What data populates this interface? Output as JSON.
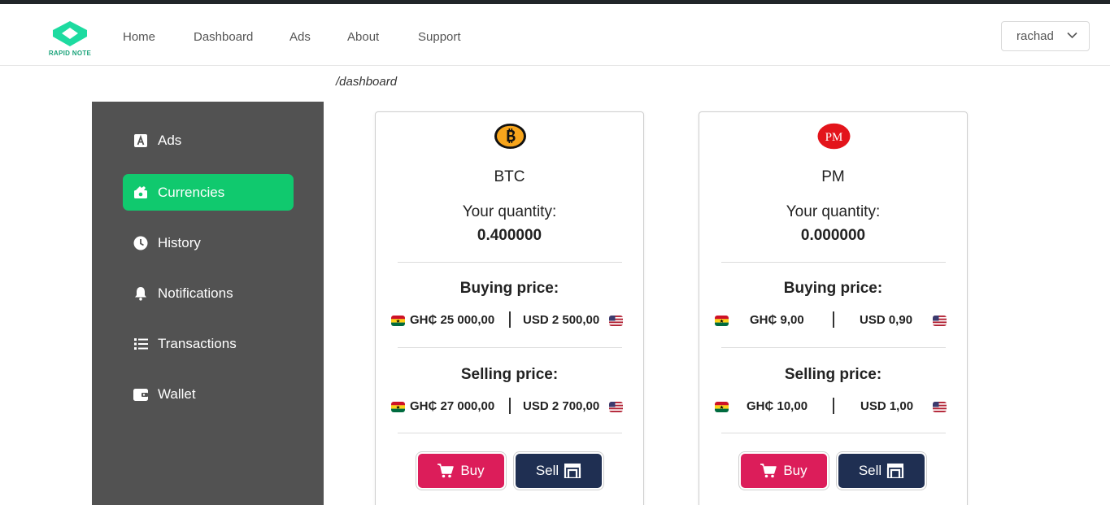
{
  "brand": {
    "name": "RAPID NOTE",
    "accent": "#1ddba0"
  },
  "nav": {
    "items": [
      {
        "label": "Home"
      },
      {
        "label": "Dashboard"
      },
      {
        "label": "Ads"
      },
      {
        "label": "About"
      },
      {
        "label": "Support"
      }
    ]
  },
  "user": {
    "name": "rachad"
  },
  "breadcrumb": "/dashboard",
  "sidebar": {
    "background": "#525252",
    "active_color": "#10c96e",
    "items": [
      {
        "label": "Ads",
        "icon": "ads-icon",
        "active": false
      },
      {
        "label": "Currencies",
        "icon": "currencies-icon",
        "active": true
      },
      {
        "label": "History",
        "icon": "clock-icon",
        "active": false
      },
      {
        "label": "Notifications",
        "icon": "bell-icon",
        "active": false
      },
      {
        "label": "Transactions",
        "icon": "list-icon",
        "active": false
      },
      {
        "label": "Wallet",
        "icon": "wallet-icon",
        "active": false
      }
    ]
  },
  "cards": [
    {
      "name": "BTC",
      "icon": "bitcoin-icon",
      "quantity_label": "Your quantity:",
      "quantity": "0.400000",
      "buying_title": "Buying price:",
      "buying_local": "GH₵ 25 000,00",
      "buying_usd": "USD 2 500,00",
      "selling_title": "Selling price:",
      "selling_local": "GH₵ 27 000,00",
      "selling_usd": "USD 2 700,00",
      "buy_label": "Buy",
      "sell_label": "Sell"
    },
    {
      "name": "PM",
      "icon": "perfect-money-icon",
      "icon_text": "PM",
      "quantity_label": "Your quantity:",
      "quantity": "0.000000",
      "buying_title": "Buying price:",
      "buying_local": "GH₵ 9,00",
      "buying_usd": "USD 0,90",
      "selling_title": "Selling price:",
      "selling_local": "GH₵ 10,00",
      "selling_usd": "USD 1,00",
      "buy_label": "Buy",
      "sell_label": "Sell"
    }
  ],
  "colors": {
    "buy": "#dc1d5a",
    "sell": "#1f2f52"
  }
}
